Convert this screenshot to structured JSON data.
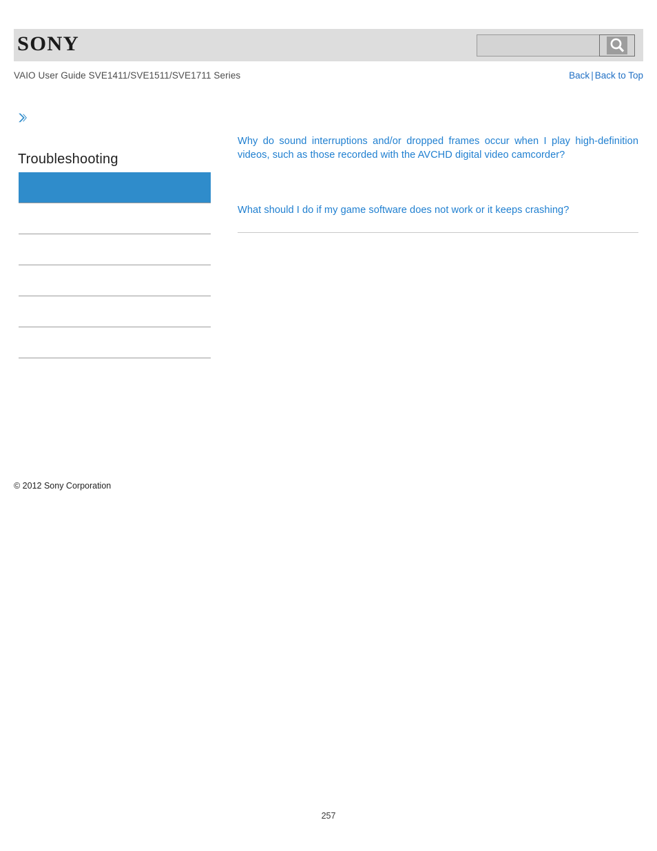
{
  "header": {
    "logo_text": "SONY",
    "background_color": "#dddddd"
  },
  "search": {
    "value": "",
    "placeholder": "",
    "icon": "search-icon",
    "button_label": ""
  },
  "subheader": {
    "guide_title": "VAIO User Guide SVE1411/SVE1511/SVE1711 Series",
    "back_label": "Back",
    "separator": "|",
    "back_to_top_label": "Back to Top",
    "link_color": "#1f6fc4"
  },
  "sidebar": {
    "chevron_icon": "double-chevron-right-icon",
    "title": "Troubleshooting",
    "selected_color": "#2f8ccb",
    "items": [
      {
        "label": "",
        "selected": true
      },
      {
        "label": "",
        "selected": false
      },
      {
        "label": "",
        "selected": false
      },
      {
        "label": "",
        "selected": false
      },
      {
        "label": "",
        "selected": false
      },
      {
        "label": "",
        "selected": false
      }
    ],
    "copyright": "© 2012 Sony Corporation"
  },
  "main": {
    "link_color": "#1f7fd0",
    "entries": [
      {
        "text": "Why do sound interruptions and/or dropped frames occur when I play high-definition videos, such as those recorded with the AVCHD digital video camcorder?"
      },
      {
        "text": "What should I do if my game software does not work or it keeps crashing?"
      }
    ]
  },
  "footer": {
    "page_number": "257"
  }
}
